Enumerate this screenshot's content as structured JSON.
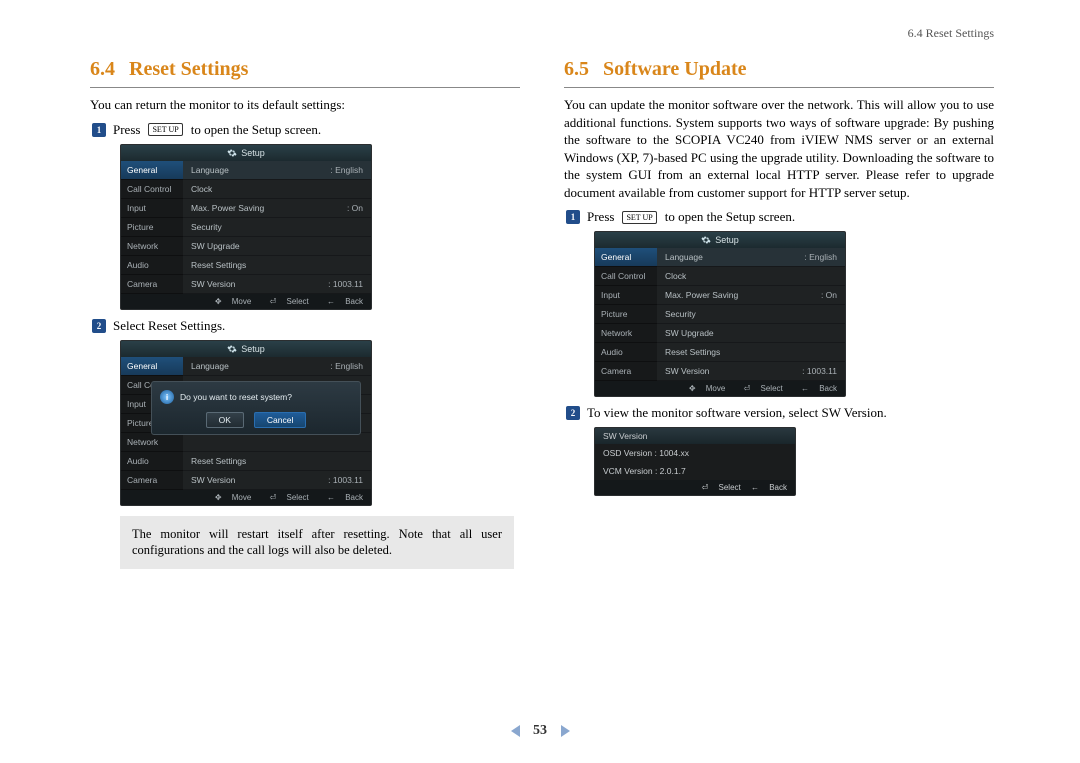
{
  "running_head": "6.4 Reset Settings",
  "left": {
    "heading_num": "6.4",
    "heading_text": "Reset Settings",
    "intro": "You can return the monitor to its default settings:",
    "step1": {
      "pre": "Press",
      "key": "SET UP",
      "post": "to open the Setup screen."
    },
    "step2": "Select Reset Settings.",
    "note": "The monitor will restart itself after resetting. Note that all user configurations and the call logs will also be deleted."
  },
  "right": {
    "heading_num": "6.5",
    "heading_text": "Software Update",
    "intro": "You can update the monitor software over the network. This will allow you to use additional functions. System supports two ways of software upgrade: By pushing the software to the SCOPIA VC240 from iVIEW NMS server or an external Windows (XP, 7)-based PC using the upgrade utility. Downloading the software to the system GUI from an external local HTTP server. Please refer to upgrade document available from customer support for HTTP server setup.",
    "step1": {
      "pre": "Press",
      "key": "SET UP",
      "post": "to open the Setup screen."
    },
    "step2": "To view the monitor software version, select SW Version."
  },
  "osd": {
    "title": "Setup",
    "side": [
      "General",
      "Call Control",
      "Input",
      "Picture",
      "Network",
      "Audio",
      "Camera"
    ],
    "rows": [
      {
        "k": "Language",
        "v": ": English"
      },
      {
        "k": "Clock",
        "v": ""
      },
      {
        "k": "Max. Power Saving",
        "v": ": On"
      },
      {
        "k": "Security",
        "v": ""
      },
      {
        "k": "SW Upgrade",
        "v": ""
      },
      {
        "k": "Reset Settings",
        "v": ""
      },
      {
        "k": "SW Version",
        "v": ": 1003.11"
      }
    ],
    "foot": {
      "move": "Move",
      "select": "Select",
      "back": "Back"
    },
    "foot_glyph": {
      "move": "✥",
      "select": "⏎",
      "back": "←"
    }
  },
  "dialog": {
    "question": "Do you want to reset system?",
    "ok": "OK",
    "cancel": "Cancel"
  },
  "swversion": {
    "title": "SW Version",
    "osd_line": "OSD Version : 1004.xx",
    "vcm_line": "VCM Version : 2.0.1.7",
    "foot_select": "Select",
    "foot_back": "Back"
  },
  "page_number": "53"
}
